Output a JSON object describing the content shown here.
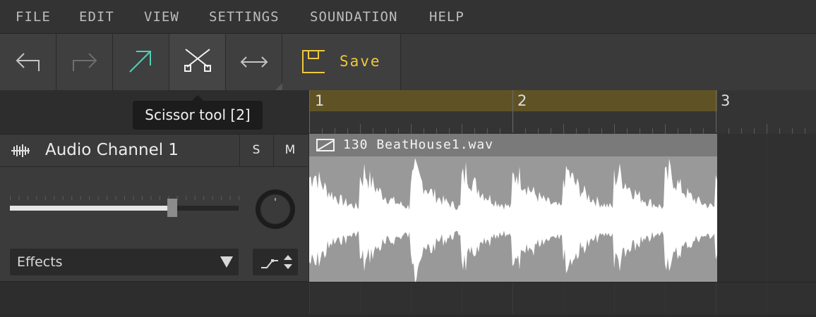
{
  "menu": [
    "FILE",
    "EDIT",
    "VIEW",
    "SETTINGS",
    "SOUNDATION",
    "HELP"
  ],
  "toolbar": {
    "save_label": "Save",
    "icons": [
      "undo-icon",
      "redo-icon",
      "pointer-tool-icon",
      "scissor-tool-icon",
      "stretch-tool-icon",
      "save-icon"
    ]
  },
  "tooltip": {
    "text": "Scissor tool [2]"
  },
  "track": {
    "name": "Audio Channel 1",
    "solo_label": "S",
    "mute_label": "M",
    "volume_level": 0.71,
    "effects_label": "Effects"
  },
  "timeline": {
    "bars": [
      "1",
      "2",
      "3"
    ]
  },
  "clip": {
    "name": "130 BeatHouse1.wav"
  },
  "colors": {
    "accent_save": "#f0c83c",
    "pointer_tool": "#4fd1b8",
    "loop_region": "#5f5326",
    "clip_body": "#999999",
    "waveform": "#ffffff"
  }
}
